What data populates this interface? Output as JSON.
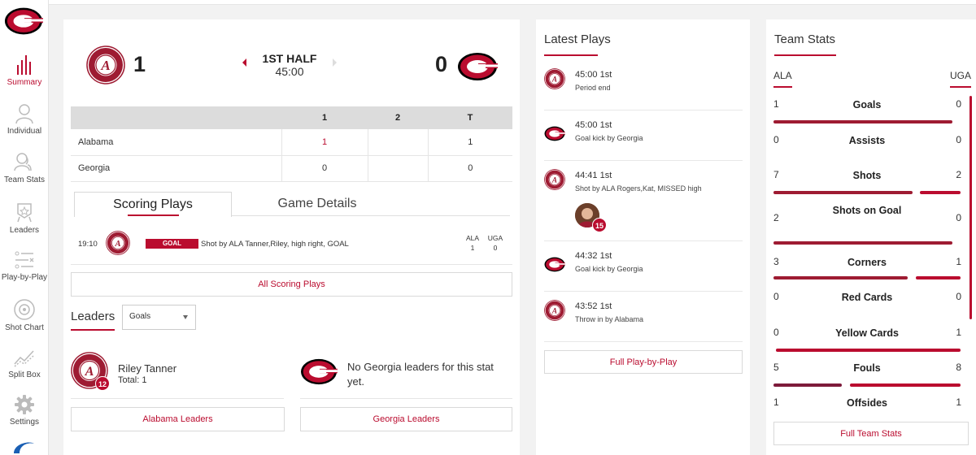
{
  "sidebar": {
    "items": [
      {
        "label": "Summary",
        "icon": "bar-chart-icon"
      },
      {
        "label": "Individual",
        "icon": "person-icon"
      },
      {
        "label": "Team Stats",
        "icon": "team-icon"
      },
      {
        "label": "Leaders",
        "icon": "award-badge-icon"
      },
      {
        "label": "Play-by-Play",
        "icon": "list-icon"
      },
      {
        "label": "Shot Chart",
        "icon": "target-icon"
      },
      {
        "label": "Split Box",
        "icon": "trend-icon"
      },
      {
        "label": "Settings",
        "icon": "gear-icon"
      }
    ],
    "active": "Summary"
  },
  "score": {
    "home_score": "1",
    "away_score": "0",
    "period": "1ST HALF",
    "clock": "45:00"
  },
  "box": {
    "headers": [
      "",
      "1",
      "2",
      "T"
    ],
    "rows": [
      {
        "team": "Alabama",
        "p1": "1",
        "p2": "",
        "t": "1"
      },
      {
        "team": "Georgia",
        "p1": "0",
        "p2": "",
        "t": "0"
      }
    ]
  },
  "tabs": {
    "scoring": "Scoring Plays",
    "details": "Game Details"
  },
  "scoring_play": {
    "time": "19:10",
    "badge": "GOAL",
    "desc": "Shot by ALA Tanner,Riley, high right, GOAL",
    "ala_label": "ALA",
    "uga_label": "UGA",
    "ala_score": "1",
    "uga_score": "0"
  },
  "all_scoring": "All Scoring Plays",
  "leaders": {
    "title": "Leaders",
    "select_value": "Goals",
    "ala_name": "Riley Tanner",
    "ala_total": "Total: 1",
    "ala_number": "12",
    "uga_msg": "No Georgia leaders for this stat yet.",
    "ala_btn": "Alabama Leaders",
    "uga_btn": "Georgia Leaders"
  },
  "latest_plays": {
    "title": "Latest Plays",
    "plays": [
      {
        "team": "ALA",
        "time": "45:00 1st",
        "desc": "Period end"
      },
      {
        "team": "UGA",
        "time": "45:00 1st",
        "desc": "Goal kick by Georgia"
      },
      {
        "team": "ALA",
        "time": "44:41 1st",
        "desc": "Shot by ALA Rogers,Kat, MISSED high",
        "player_number": "15"
      },
      {
        "team": "UGA",
        "time": "44:32 1st",
        "desc": "Goal kick by Georgia"
      },
      {
        "team": "ALA",
        "time": "43:52 1st",
        "desc": "Throw in by Alabama"
      }
    ],
    "button": "Full Play-by-Play"
  },
  "team_stats": {
    "title": "Team Stats",
    "ala": "ALA",
    "uga": "UGA",
    "stats": [
      {
        "name": "Goals",
        "ala": "1",
        "uga": "0"
      },
      {
        "name": "Assists",
        "ala": "0",
        "uga": "0"
      },
      {
        "name": "Shots",
        "ala": "7",
        "uga": "2"
      },
      {
        "name": "Shots on Goal",
        "ala": "2",
        "uga": "0"
      },
      {
        "name": "Corners",
        "ala": "3",
        "uga": "1"
      },
      {
        "name": "Red Cards",
        "ala": "0",
        "uga": "0"
      },
      {
        "name": "Yellow Cards",
        "ala": "0",
        "uga": "1"
      },
      {
        "name": "Fouls",
        "ala": "5",
        "uga": "8"
      },
      {
        "name": "Offsides",
        "ala": "1",
        "uga": "1"
      }
    ],
    "button": "Full Team Stats"
  },
  "colors": {
    "accent": "#ba0c2f",
    "alabama_crimson": "#9e1b32",
    "georgia_red": "#ba0c2f"
  }
}
